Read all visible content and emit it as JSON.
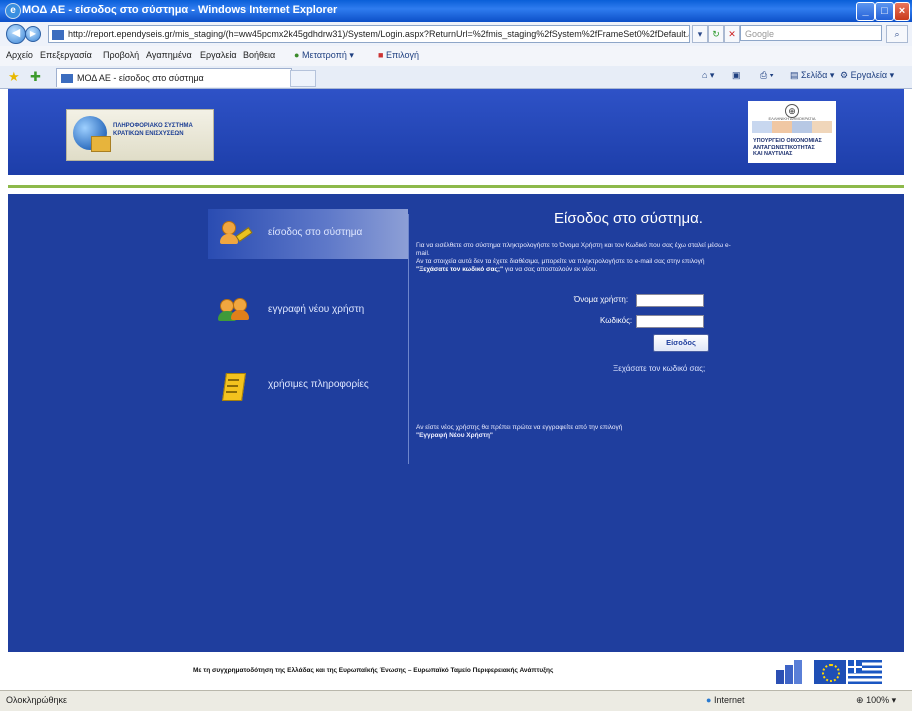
{
  "window": {
    "title": "ΜΟΔ ΑΕ - είσοδος στο σύστημα - Windows Internet Explorer"
  },
  "browser": {
    "url": "http://report.ependyseis.gr/mis_staging/(h=ww45pcmx2k45gdhdrw31)/System/Login.aspx?ReturnUrl=%2fmis_staging%2fSystem%2fFrameSet0%2fDefault.aspx",
    "search_placeholder": "Google",
    "menu": [
      "Αρχείο",
      "Επεξεργασία",
      "Προβολή",
      "Αγαπημένα",
      "Εργαλεία",
      "Βοήθεια"
    ],
    "toolbar_convert": "Μετατροπή",
    "toolbar_select": "Επιλογή",
    "tab_title": "ΜΟΔ ΑΕ - είσοδος στο σύστημα",
    "cmd_page": "Σελίδα",
    "cmd_tools": "Εργαλεία",
    "status_left": "Ολοκληρώθηκε",
    "status_zone": "Internet",
    "status_zoom": "100%"
  },
  "header": {
    "logo_left_lines": [
      "ΠΛΗΡΟΦΟΡΙΑΚΟ ΣΥΣΤΗΜΑ",
      "ΚΡΑΤΙΚΩΝ ΕΝΙΣΧΥΣΕΩΝ"
    ],
    "logo_right_top": "ΕΛΛΗΝΙΚΗ ΔΗΜΟΚΡΑΤΙΑ",
    "logo_right_lines": [
      "ΥΠΟΥΡΓΕΙΟ ΟΙΚΟΝΟΜΙΑΣ",
      "ΑΝΤΑΓΩΝΙΣΤΙΚΟΤΗΤΑΣ",
      "ΚΑΙ ΝΑΥΤΙΛΙΑΣ"
    ]
  },
  "nav": {
    "login": "είσοδος στο σύστημα",
    "register": "εγγραφή νέου χρήστη",
    "info": "χρήσιμες πληροφορίες"
  },
  "login": {
    "title": "Είσοδος στο σύστημα.",
    "intro_a": "Για να εισέλθετε στο σύστημα πληκτρολογήστε το Όνομα Χρήστη και τον Κωδικό που σας έχω σταλεί μέσω e-mail.",
    "intro_b": "Αν τα στοιχεία αυτά δεν τα έχετε διαθέσιμα, μπορείτε να πληκτρολογήστε το e-mail σας στην επιλογή ",
    "intro_link": "\"Ξεχάσατε τον κωδικό σας;\"",
    "intro_c": " για να σας αποσταλούν εκ νέου.",
    "username_label": "Όνομα χρήστη:",
    "password_label": "Κωδικός:",
    "submit": "Είσοδος",
    "forgot": "Ξεχάσατε τον κωδικό σας;",
    "new_user_a": "Αν είστε νέος χρήστης θα πρέπει πρώτα να εγγραφείτε από την επιλογή ",
    "new_user_link": "\"Εγγραφή Νέου Χρήστη\""
  },
  "footer": {
    "text": "Με τη συγχρηματοδότηση της Ελλάδας και της Ευρωπαϊκής Ένωσης – Ευρωπαϊκό Ταμείο Περιφερειακής Ανάπτυξης"
  }
}
